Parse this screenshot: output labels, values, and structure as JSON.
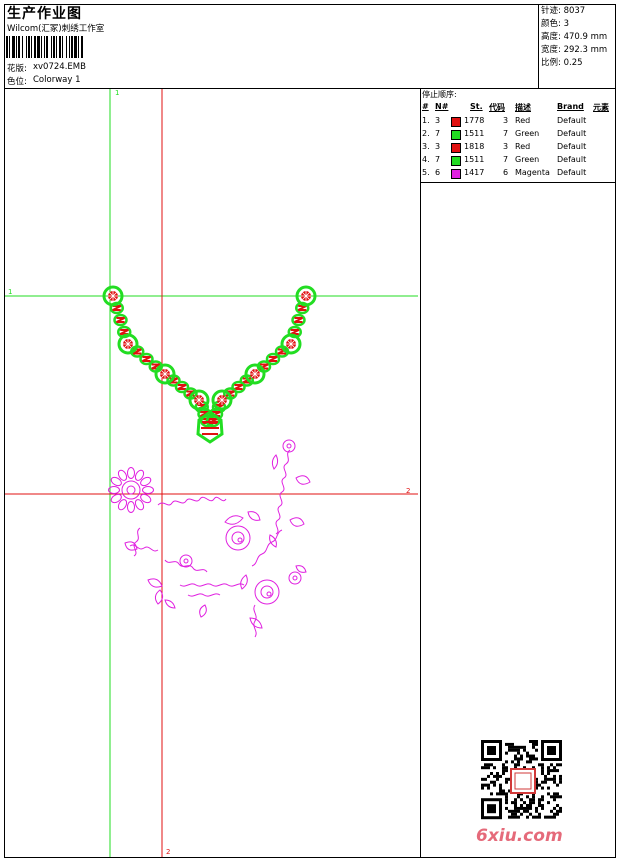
{
  "header": {
    "title": "生产作业图",
    "company": "Wilcom(汇冢)刺绣工作室",
    "design_label": "花版:",
    "design_name": "xv0724.EMB",
    "color_label": "色位:",
    "colorway": "Colorway 1"
  },
  "stats": [
    {
      "label": "针迹:",
      "value": "8037"
    },
    {
      "label": "颜色:",
      "value": "3"
    },
    {
      "label": "高度:",
      "value": "470.9 mm"
    },
    {
      "label": "宽度:",
      "value": "292.3 mm"
    },
    {
      "label": "比例:",
      "value": "0.25"
    }
  ],
  "stop_sequence": {
    "title": "停止顺序:",
    "columns": [
      "#",
      "N#",
      "St.",
      "代码",
      "描述",
      "Brand",
      "元素"
    ],
    "rows": [
      {
        "index": "1.",
        "n": "3",
        "color": "#e01010",
        "stitches": "1778",
        "code": "3",
        "desc": "Red",
        "brand": "Default"
      },
      {
        "index": "2.",
        "n": "7",
        "color": "#22dd22",
        "stitches": "1511",
        "code": "7",
        "desc": "Green",
        "brand": "Default"
      },
      {
        "index": "3.",
        "n": "3",
        "color": "#e01010",
        "stitches": "1818",
        "code": "3",
        "desc": "Red",
        "brand": "Default"
      },
      {
        "index": "4.",
        "n": "7",
        "color": "#22dd22",
        "stitches": "1511",
        "code": "7",
        "desc": "Green",
        "brand": "Default"
      },
      {
        "index": "5.",
        "n": "6",
        "color": "#e020e0",
        "stitches": "1417",
        "code": "6",
        "desc": "Magenta",
        "brand": "Default"
      }
    ]
  },
  "guides": {
    "label_1_top": "1",
    "label_1_left": "1",
    "label_2_right": "2",
    "label_2_bottom": "2"
  },
  "watermark": "6xiu.com",
  "colors": {
    "guide_green": "#22dd22",
    "guide_red": "#e01010",
    "thread_red": "#e01010",
    "thread_green": "#22dd22",
    "thread_magenta": "#e020e0"
  }
}
